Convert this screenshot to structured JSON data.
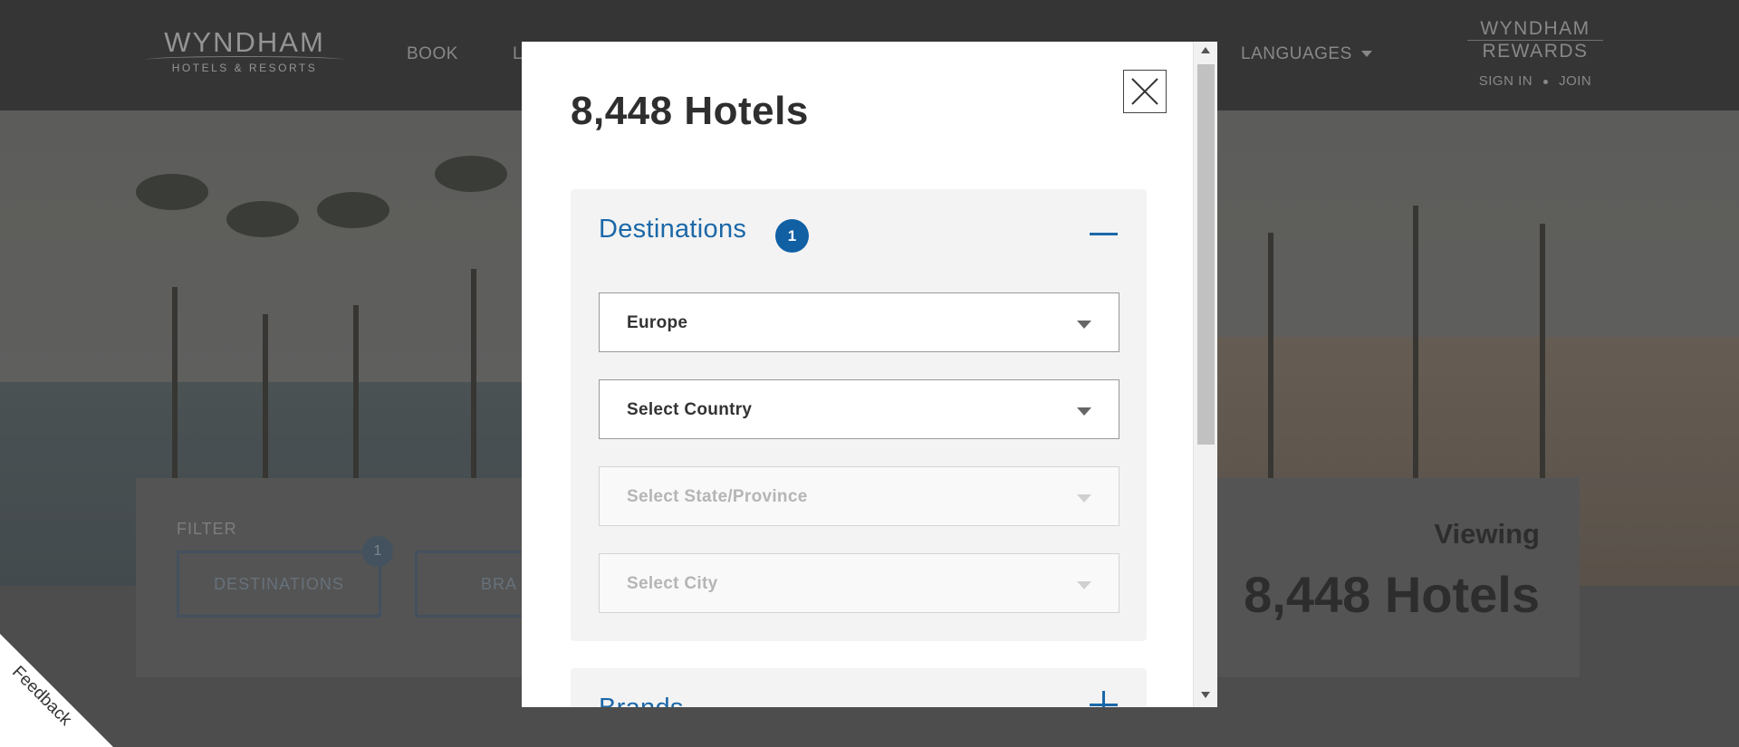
{
  "header": {
    "logo_main": "WYNDHAM",
    "logo_sub": "HOTELS & RESORTS",
    "nav": {
      "book": "BOOK",
      "partial": "L",
      "languages": "LANGUAGES"
    },
    "rewards": {
      "line1": "WYNDHAM",
      "line2": "REWARDS",
      "sign_in": "SIGN IN",
      "join": "JOIN"
    }
  },
  "filter_bar": {
    "label": "FILTER",
    "destinations_button": "DESTINATIONS",
    "destinations_count": "1",
    "brands_button_partial": "BRA",
    "viewing_label": "Viewing",
    "viewing_count": "8,448 Hotels"
  },
  "feedback": {
    "label": "Feedback"
  },
  "modal": {
    "title": "8,448 Hotels",
    "destinations": {
      "title": "Destinations",
      "badge": "1",
      "region": {
        "value": "Europe"
      },
      "country": {
        "value": "Select Country"
      },
      "state": {
        "value": "Select State/Province"
      },
      "city": {
        "value": "Select City"
      }
    },
    "brands": {
      "title": "Brands"
    }
  },
  "colors": {
    "accent_blue": "#1b68a8",
    "badge_blue": "#1160a4",
    "nav_bg": "#3a3a3a"
  }
}
